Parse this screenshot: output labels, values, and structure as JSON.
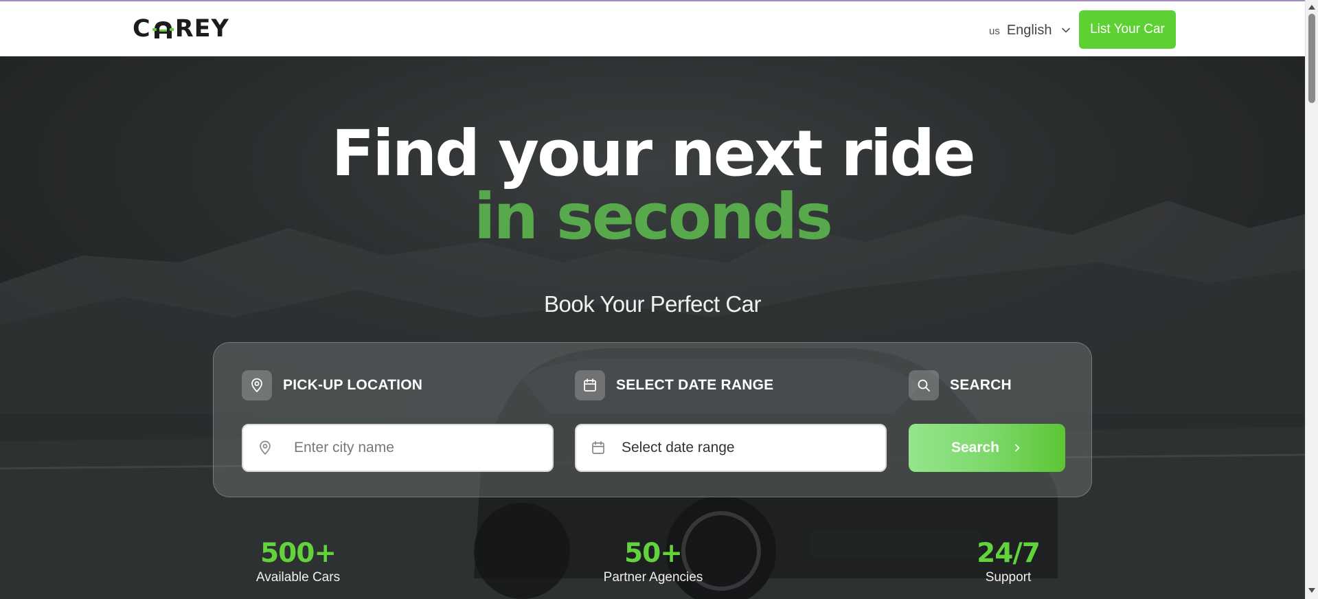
{
  "brand": {
    "logo_text_before": "C",
    "logo_text_after": "REY",
    "accent_color": "#5dd134"
  },
  "header": {
    "flag_code": "us",
    "language": "English",
    "list_car_label": "List Your Car"
  },
  "hero": {
    "title_line1": "Find your next ride",
    "title_line2": "in seconds",
    "subtitle": "Book Your Perfect Car"
  },
  "booking": {
    "pickup_label": "PICK-UP LOCATION",
    "pickup_placeholder": "Enter city name",
    "date_label": "SELECT DATE RANGE",
    "date_value": "Select date range",
    "search_label": "SEARCH",
    "search_button": "Search"
  },
  "stats": [
    {
      "value": "500+",
      "caption": "Available Cars"
    },
    {
      "value": "50+",
      "caption": "Partner Agencies"
    },
    {
      "value": "24/7",
      "caption": "Support"
    }
  ],
  "icons": {
    "pickup": "map-pin-icon",
    "date": "calendar-icon",
    "search": "search-icon",
    "language": "chevron-down-icon",
    "search_button": "chevron-right-icon"
  }
}
